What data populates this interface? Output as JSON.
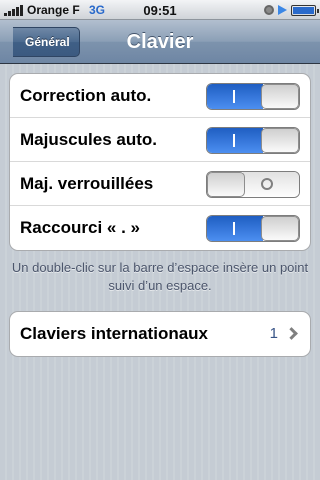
{
  "status_bar": {
    "carrier": "Orange F",
    "network": "3G",
    "time": "09:51",
    "icons": [
      "signal-icon",
      "lock-icon",
      "play-icon",
      "battery-icon"
    ]
  },
  "nav": {
    "back_label": "Général",
    "title": "Clavier"
  },
  "settings": {
    "rows": [
      {
        "label": "Correction auto.",
        "on": true
      },
      {
        "label": "Majuscules auto.",
        "on": true
      },
      {
        "label": "Maj. verrouillées",
        "on": false
      },
      {
        "label": "Raccourci « . »",
        "on": true
      }
    ],
    "footer": "Un double-clic sur la barre d’espace insère un point suivi d’un espace."
  },
  "international": {
    "label": "Claviers internationaux",
    "value": "1"
  },
  "colors": {
    "switch_on": "#2f73d8",
    "nav_bar": "#7d93ad",
    "background": "#c5ccd4",
    "footer_text": "#4c566c",
    "detail_value": "#385487"
  }
}
